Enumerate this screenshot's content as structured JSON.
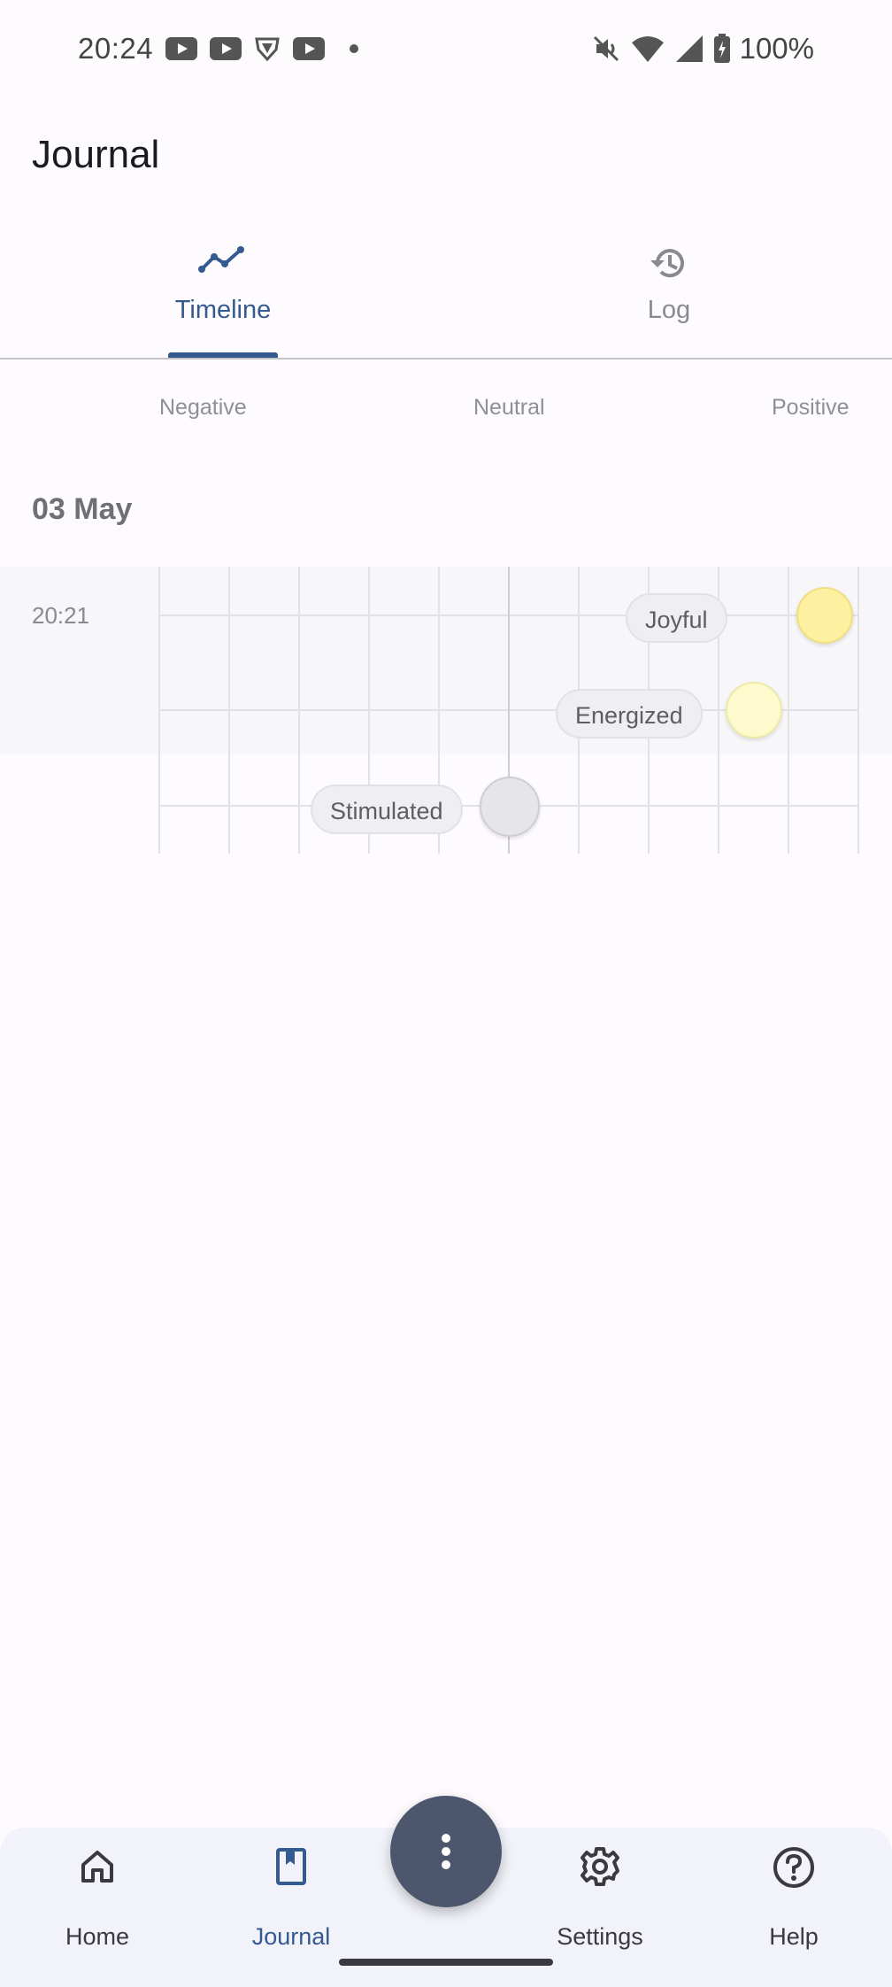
{
  "status_bar": {
    "time": "20:24",
    "left_icons": [
      "youtube-icon",
      "youtube-icon",
      "vpn-shield-icon",
      "youtube-icon",
      "notification-dot-icon"
    ],
    "right_icons": [
      "mute-icon",
      "wifi-icon",
      "cell-signal-icon",
      "battery-charging-icon"
    ],
    "battery": "100%"
  },
  "app": {
    "title": "Journal"
  },
  "tabs": [
    {
      "label": "Timeline",
      "icon": "trend-line-icon",
      "active": true
    },
    {
      "label": "Log",
      "icon": "history-icon",
      "active": false
    }
  ],
  "scale": {
    "negative": "Negative",
    "neutral": "Neutral",
    "positive": "Positive"
  },
  "day": {
    "date": "03 May",
    "entries": [
      {
        "time": "20:21",
        "moods": [
          {
            "label": "Joyful",
            "color": "#fdf0a0",
            "border": "#f1de80"
          },
          {
            "label": "Energized",
            "color": "#fdfacd",
            "border": "#efe9a8"
          },
          {
            "label": "Stimulated",
            "color": "#e6e5e8",
            "border": "#cfcfd3"
          }
        ]
      }
    ]
  },
  "bottom_nav": {
    "items": [
      {
        "label": "Home",
        "icon": "home-icon",
        "active": false
      },
      {
        "label": "Journal",
        "icon": "journal-bookmark-icon",
        "active": true
      },
      {
        "label": "Settings",
        "icon": "gear-icon",
        "active": false
      },
      {
        "label": "Help",
        "icon": "help-circle-icon",
        "active": false
      }
    ],
    "fab_icon": "more-vertical-icon"
  },
  "colors": {
    "accent": "#355a8f",
    "fab": "#4c566d",
    "background": "#fefbff",
    "nav_background": "#f2f3fa"
  }
}
